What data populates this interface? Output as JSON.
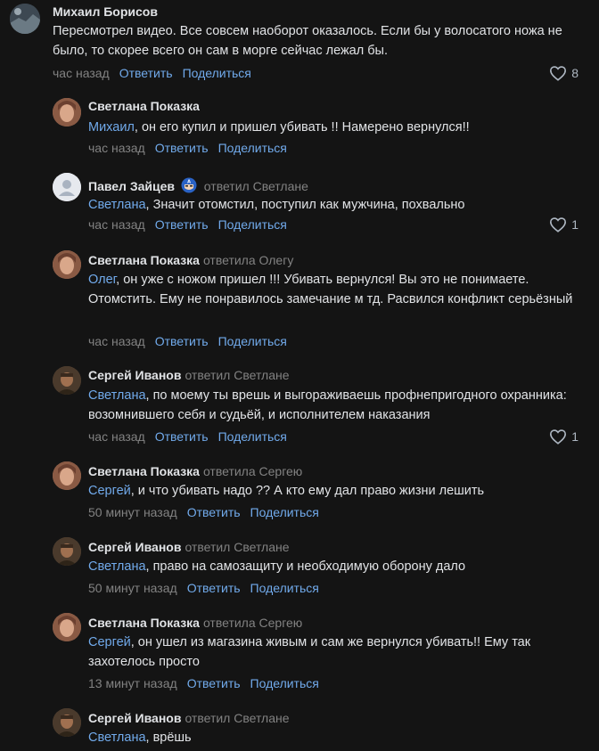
{
  "comments": [
    {
      "author": "Михаил Борисов",
      "reply_to": "",
      "mention": "",
      "text": "Пересмотрел видео. Все совсем наоборот оказалось. Если бы у волосатого ножа не было, то скорее всего он сам в морге сейчас лежал бы.",
      "time": "час назад",
      "reply_label": "Ответить",
      "share_label": "Поделиться",
      "likes": "8"
    },
    {
      "author": "Светлана Показка",
      "reply_to": "",
      "mention": "Михаил",
      "text": ", он его купил и пришел убивать !! Намерено вернулся!!",
      "time": "час назад",
      "reply_label": "Ответить",
      "share_label": "Поделиться",
      "likes": ""
    },
    {
      "author": "Павел Зайцев",
      "reply_to": "ответил Светлане",
      "mention": "Светлана",
      "text": ", Значит отомстил, поступил как мужчина, похвально",
      "time": "час назад",
      "reply_label": "Ответить",
      "share_label": "Поделиться",
      "likes": "1"
    },
    {
      "author": "Светлана Показка",
      "reply_to": "ответила Олегу",
      "mention": "Олег",
      "text": ", он уже с ножом пришел !!! Убивать вернулся! Вы это не понимаете. Отомстить. Ему не понравилось замечание м тд. Расвился конфликт серьёзный",
      "time": "час назад",
      "reply_label": "Ответить",
      "share_label": "Поделиться",
      "likes": ""
    },
    {
      "author": "Сергей Иванов",
      "reply_to": "ответил Светлане",
      "mention": "Светлана",
      "text": ", по моему ты врешь и выгораживаешь профнепригодного охранника: возомнившего себя и судьёй, и исполнителем наказания",
      "time": "час назад",
      "reply_label": "Ответить",
      "share_label": "Поделиться",
      "likes": "1"
    },
    {
      "author": "Светлана Показка",
      "reply_to": "ответила Сергею",
      "mention": "Сергей",
      "text": ", и что убивать надо ?? А кто ему дал право жизни лешить",
      "time": "50 минут назад",
      "reply_label": "Ответить",
      "share_label": "Поделиться",
      "likes": ""
    },
    {
      "author": "Сергей Иванов",
      "reply_to": "ответил Светлане",
      "mention": "Светлана",
      "text": ", право на самозащиту и необходимую оборону дало",
      "time": "50 минут назад",
      "reply_label": "Ответить",
      "share_label": "Поделиться",
      "likes": ""
    },
    {
      "author": "Светлана Показка",
      "reply_to": "ответила Сергею",
      "mention": "Сергей",
      "text": ", он ушел из магазина живым и сам же вернулся убивать!! Ему так захотелось просто",
      "time": "13 минут назад",
      "reply_label": "Ответить",
      "share_label": "Поделиться",
      "likes": ""
    },
    {
      "author": "Сергей Иванов",
      "reply_to": "ответил Светлане",
      "mention": "Светлана",
      "text": ", врёшь",
      "time": "",
      "reply_label": "",
      "share_label": "",
      "likes": ""
    }
  ],
  "icons": {
    "like": "heart-outline-icon",
    "badge": "captain-america-emoji-icon"
  },
  "colors": {
    "background": "#141414",
    "link": "#71aaeb",
    "muted": "#828282",
    "text": "#e1e3e6"
  }
}
